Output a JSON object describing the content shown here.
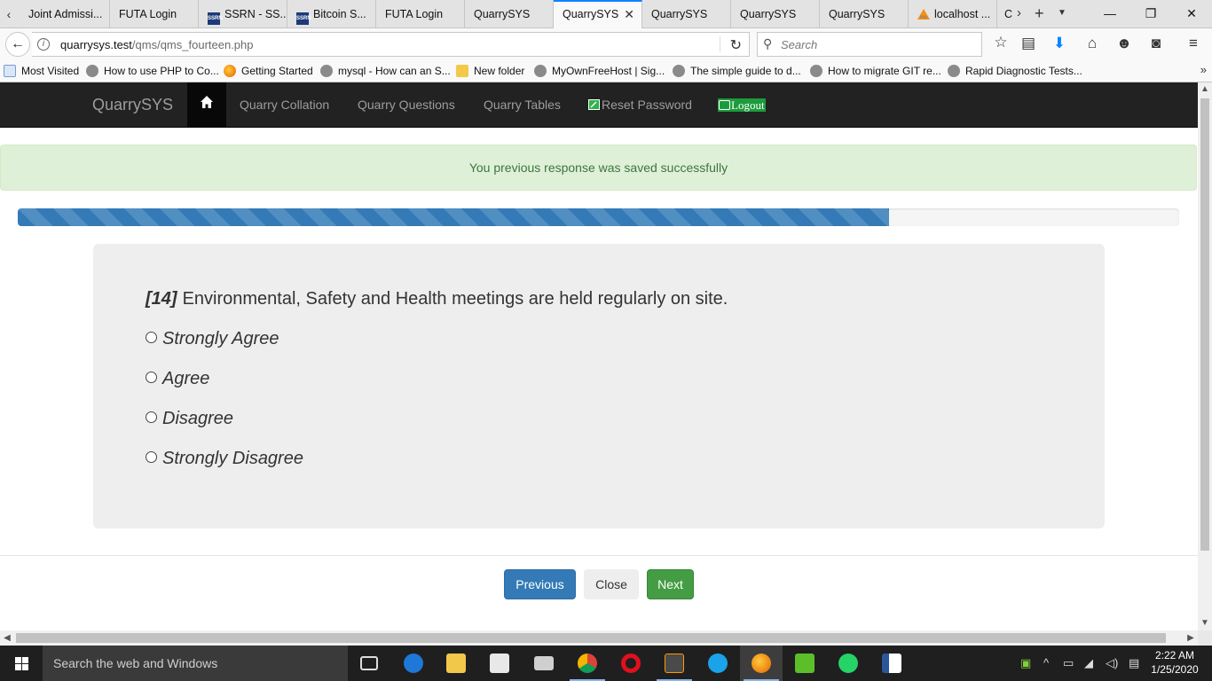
{
  "browser": {
    "tabs": [
      {
        "label": "Joint Admissi...",
        "icon": "page-icon",
        "active": false
      },
      {
        "label": "FUTA Login",
        "icon": "page-icon",
        "active": false
      },
      {
        "label": "SSRN - SS...",
        "icon": "ssrn-icon",
        "active": false
      },
      {
        "label": "Bitcoin S...",
        "icon": "ssrn-icon",
        "active": false
      },
      {
        "label": "FUTA Login",
        "icon": "page-icon",
        "active": false
      },
      {
        "label": "QuarrySYS",
        "icon": "page-icon",
        "active": false
      },
      {
        "label": "QuarrySYS",
        "icon": "page-icon",
        "active": true
      },
      {
        "label": "QuarrySYS",
        "icon": "page-icon",
        "active": false
      },
      {
        "label": "QuarrySYS",
        "icon": "page-icon",
        "active": false
      },
      {
        "label": "QuarrySYS",
        "icon": "page-icon",
        "active": false
      },
      {
        "label": "localhost ...",
        "icon": "phpmyadmin-icon",
        "active": false
      },
      {
        "label": "C",
        "icon": "page-icon",
        "active": false
      }
    ],
    "url_host": "quarrysys.test",
    "url_path": "/qms/qms_fourteen.php",
    "search_placeholder": "Search",
    "bookmarks": [
      {
        "label": "Most Visited",
        "icon": "page"
      },
      {
        "label": "How to use PHP to Co...",
        "icon": "globe"
      },
      {
        "label": "Getting Started",
        "icon": "firefox"
      },
      {
        "label": "mysql - How can an S...",
        "icon": "globe"
      },
      {
        "label": "New folder",
        "icon": "folder"
      },
      {
        "label": "MyOwnFreeHost | Sig...",
        "icon": "globe"
      },
      {
        "label": "The simple guide to d...",
        "icon": "globe"
      },
      {
        "label": "How to migrate GIT re...",
        "icon": "globe"
      },
      {
        "label": "Rapid Diagnostic Tests...",
        "icon": "globe"
      }
    ]
  },
  "site": {
    "brand": "QuarrySYS",
    "nav": {
      "collation": "Quarry Collation",
      "questions": "Quarry Questions",
      "tables": "Quarry Tables",
      "reset_password": "Reset Password",
      "logout": "Logout"
    },
    "alert": "You previous response was saved successfully",
    "progress": 0.75,
    "question": {
      "number": "[14]",
      "text": "Environmental, Safety and Health meetings are held regularly on site.",
      "options": [
        "Strongly Agree",
        "Agree",
        "Disagree",
        "Strongly Disagree"
      ]
    },
    "buttons": {
      "previous": "Previous",
      "close": "Close",
      "next": "Next"
    }
  },
  "taskbar": {
    "search_placeholder": "Search the web and Windows",
    "time": "2:22 AM",
    "date": "1/25/2020"
  },
  "colors": {
    "navbar": "#222222",
    "alert_bg": "#dff0d8",
    "alert_text": "#3c763d",
    "progress": "#337ab7",
    "primary": "#337ab7",
    "success": "#449d44",
    "logout_bg": "#1c9b3b"
  }
}
